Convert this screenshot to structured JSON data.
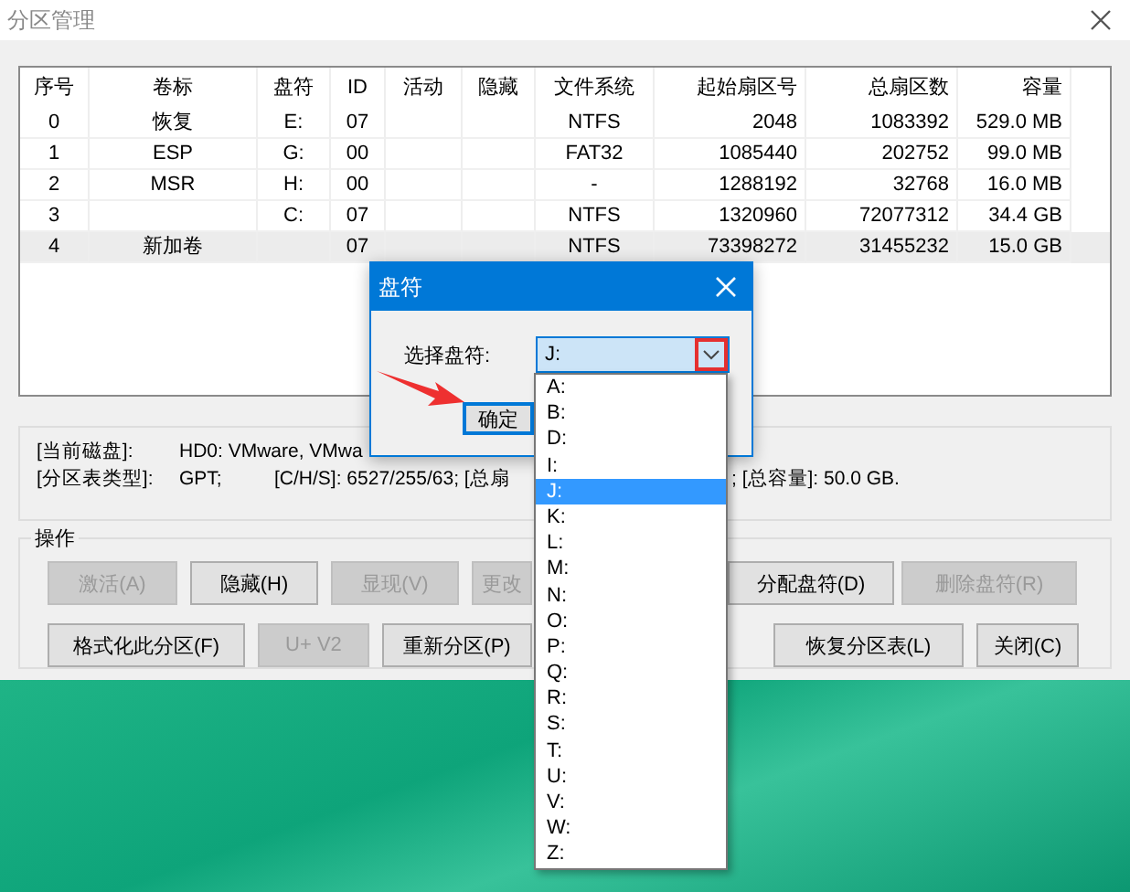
{
  "window": {
    "title": "分区管理"
  },
  "table": {
    "columns": [
      "序号",
      "卷标",
      "盘符",
      "ID",
      "活动",
      "隐藏",
      "文件系统",
      "起始扇区号",
      "总扇区数",
      "容量"
    ],
    "rows": [
      {
        "cells": [
          "0",
          "恢复",
          "E:",
          "07",
          "",
          "",
          "NTFS",
          "2048",
          "1083392",
          "529.0 MB"
        ],
        "selected": false
      },
      {
        "cells": [
          "1",
          "ESP",
          "G:",
          "00",
          "",
          "",
          "FAT32",
          "1085440",
          "202752",
          "99.0 MB"
        ],
        "selected": false
      },
      {
        "cells": [
          "2",
          "MSR",
          "H:",
          "00",
          "",
          "",
          "-",
          "1288192",
          "32768",
          "16.0 MB"
        ],
        "selected": false
      },
      {
        "cells": [
          "3",
          "",
          "C:",
          "07",
          "",
          "",
          "NTFS",
          "1320960",
          "72077312",
          "34.4 GB"
        ],
        "selected": false
      },
      {
        "cells": [
          "4",
          "新加卷",
          "",
          "07",
          "",
          "",
          "NTFS",
          "73398272",
          "31455232",
          "15.0 GB"
        ],
        "selected": true
      }
    ]
  },
  "disk_info": {
    "line1": {
      "label": "[当前磁盘]:",
      "value": "HD0: VMware, VMwa"
    },
    "line2": {
      "label": "[分区表类型]:",
      "value": "GPT;",
      "chs": "[C/H/S]: 6527/255/63; [总扇",
      "total": "; [总容量]: 50.0 GB."
    }
  },
  "operations": {
    "title": "操作",
    "row1": [
      {
        "label": "激活(A)",
        "disabled": true
      },
      {
        "label": "隐藏(H)",
        "disabled": false
      },
      {
        "label": "显现(V)",
        "disabled": true
      },
      {
        "label": "更改",
        "disabled": true
      },
      {
        "label": "分配盘符(D)",
        "disabled": false
      },
      {
        "label": "删除盘符(R)",
        "disabled": true
      }
    ],
    "row2": [
      {
        "label": "格式化此分区(F)",
        "disabled": false
      },
      {
        "label": "U+ V2",
        "disabled": true
      },
      {
        "label": "重新分区(P)",
        "disabled": false
      },
      {
        "label": "恢复分区表(L)",
        "disabled": false
      },
      {
        "label": "关闭(C)",
        "disabled": false
      }
    ]
  },
  "dialog": {
    "title": "盘符",
    "field_label": "选择盘符:",
    "value": "J:",
    "ok": "确定"
  },
  "dropdown": [
    {
      "label": "A:",
      "selected": false
    },
    {
      "label": "B:",
      "selected": false
    },
    {
      "label": "D:",
      "selected": false
    },
    {
      "label": "I:",
      "selected": false
    },
    {
      "label": "J:",
      "selected": true
    },
    {
      "label": "K:",
      "selected": false
    },
    {
      "label": "L:",
      "selected": false
    },
    {
      "label": "M:",
      "selected": false
    },
    {
      "label": "N:",
      "selected": false
    },
    {
      "label": "O:",
      "selected": false
    },
    {
      "label": "P:",
      "selected": false
    },
    {
      "label": "Q:",
      "selected": false
    },
    {
      "label": "R:",
      "selected": false
    },
    {
      "label": "S:",
      "selected": false
    },
    {
      "label": "T:",
      "selected": false
    },
    {
      "label": "U:",
      "selected": false
    },
    {
      "label": "V:",
      "selected": false
    },
    {
      "label": "W:",
      "selected": false
    },
    {
      "label": "Z:",
      "selected": false
    }
  ]
}
